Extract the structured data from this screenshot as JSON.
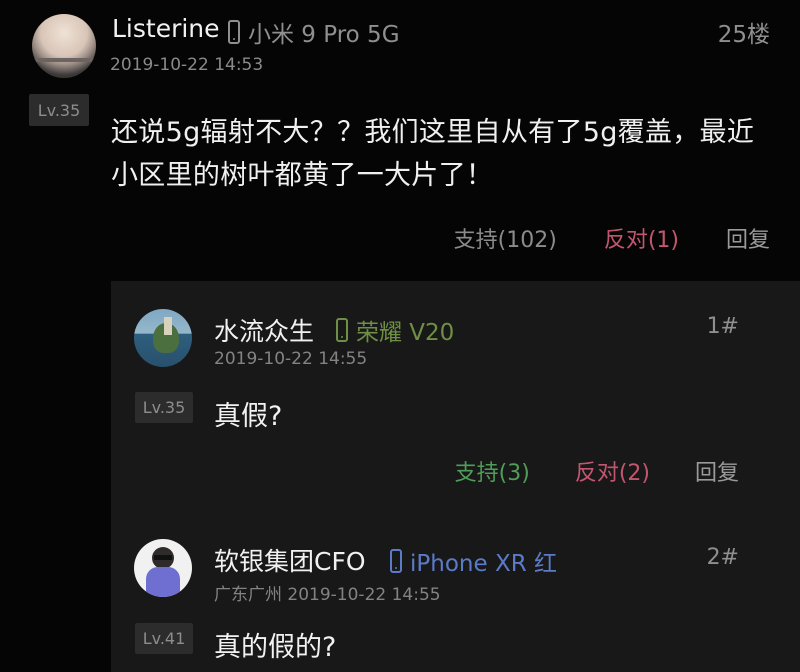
{
  "main_post": {
    "username": "Listerine",
    "device": "小米 9 Pro 5G",
    "floor": "25楼",
    "date": "2019-10-22 14:53",
    "level": "Lv.35",
    "content": "还说5g辐射不大？？我们这里自从有了5g覆盖，最近小区里的树叶都黄了一大片了！",
    "actions": {
      "support": "支持(102)",
      "oppose": "反对(1)",
      "reply": "回复"
    }
  },
  "replies": [
    {
      "username": "水流众生",
      "device": "荣耀 V20",
      "floor": "1#",
      "date": "2019-10-22 14:55",
      "level": "Lv.35",
      "content": "真假?",
      "actions": {
        "support": "支持(3)",
        "oppose": "反对(2)",
        "reply": "回复"
      },
      "device_color": "#6e8f45"
    },
    {
      "username": "软银集团CFO",
      "device": "iPhone XR 红",
      "floor": "2#",
      "location_date": "广东广州 2019-10-22 14:55",
      "level": "Lv.41",
      "content": "真的假的?",
      "device_color": "#5b7bc8"
    }
  ],
  "colors": {
    "background": "#050505",
    "reply_background": "#181818",
    "support_green": "#4f9d59",
    "oppose_red": "#c3566f",
    "muted_gray": "#8f8f8f"
  },
  "icons": {
    "device": "phone-icon",
    "avatar_main": "sunset-avatar",
    "avatar_reply_1": "island-avatar",
    "avatar_reply_2": "cartoon-person-avatar"
  }
}
